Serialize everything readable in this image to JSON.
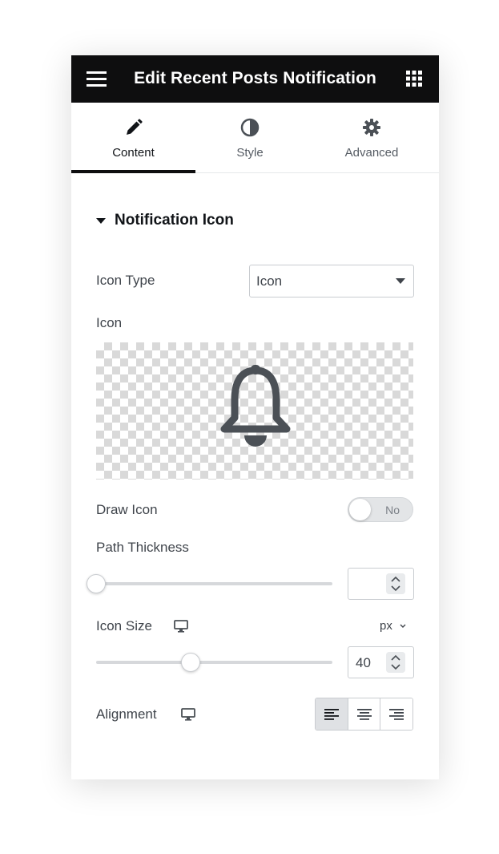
{
  "header": {
    "title": "Edit Recent Posts Notification"
  },
  "tabs": [
    {
      "label": "Content",
      "icon": "pencil-icon",
      "active": true
    },
    {
      "label": "Style",
      "icon": "contrast-icon",
      "active": false
    },
    {
      "label": "Advanced",
      "icon": "gear-icon",
      "active": false
    }
  ],
  "section": {
    "title": "Notification Icon"
  },
  "fields": {
    "icon_type": {
      "label": "Icon Type",
      "value": "Icon"
    },
    "icon": {
      "label": "Icon",
      "preview_icon": "bell-icon"
    },
    "draw_icon": {
      "label": "Draw Icon",
      "value": "No",
      "on": false
    },
    "path_thickness": {
      "label": "Path Thickness",
      "value": "",
      "slider_fraction": 0.0
    },
    "icon_size": {
      "label": "Icon Size",
      "unit": "px",
      "value": "40",
      "slider_fraction": 0.4
    },
    "alignment": {
      "label": "Alignment",
      "options": [
        "align-left-icon",
        "align-center-icon",
        "align-right-icon"
      ],
      "selected": "align-left-icon"
    }
  },
  "colors": {
    "header_bg": "#0e0e0f",
    "icon_gray": "#4b5056",
    "active_tab_indicator": "#0e0e0f"
  }
}
